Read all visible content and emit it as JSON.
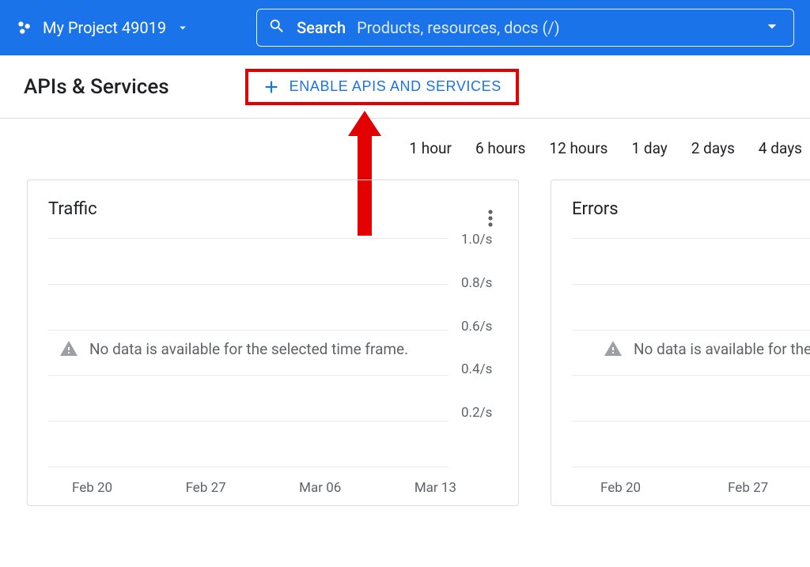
{
  "header": {
    "project_name": "My Project 49019",
    "search_label": "Search",
    "search_placeholder": "Products, resources, docs (/)"
  },
  "subheader": {
    "title": "APIs & Services",
    "enable_button": "ENABLE APIS AND SERVICES"
  },
  "time_ranges": [
    "1 hour",
    "6 hours",
    "12 hours",
    "1 day",
    "2 days",
    "4 days"
  ],
  "cards": {
    "traffic": {
      "title": "Traffic",
      "nodata": "No data is available for the selected time frame."
    },
    "errors": {
      "title": "Errors",
      "nodata": "No data is available for the"
    }
  },
  "chart_data": [
    {
      "type": "line",
      "title": "Traffic",
      "xlabel": "",
      "ylabel": "",
      "ylim": [
        0,
        1.0
      ],
      "y_tick_labels": [
        "1.0/s",
        "0.8/s",
        "0.6/s",
        "0.4/s",
        "0.2/s"
      ],
      "categories": [
        "Feb 20",
        "Feb 27",
        "Mar 06",
        "Mar 13"
      ],
      "series": [],
      "note": "No data is available for the selected time frame."
    },
    {
      "type": "line",
      "title": "Errors",
      "xlabel": "",
      "ylabel": "",
      "categories": [
        "Feb 20",
        "Feb 27"
      ],
      "series": [],
      "note": "No data is available for the selected time frame."
    }
  ]
}
